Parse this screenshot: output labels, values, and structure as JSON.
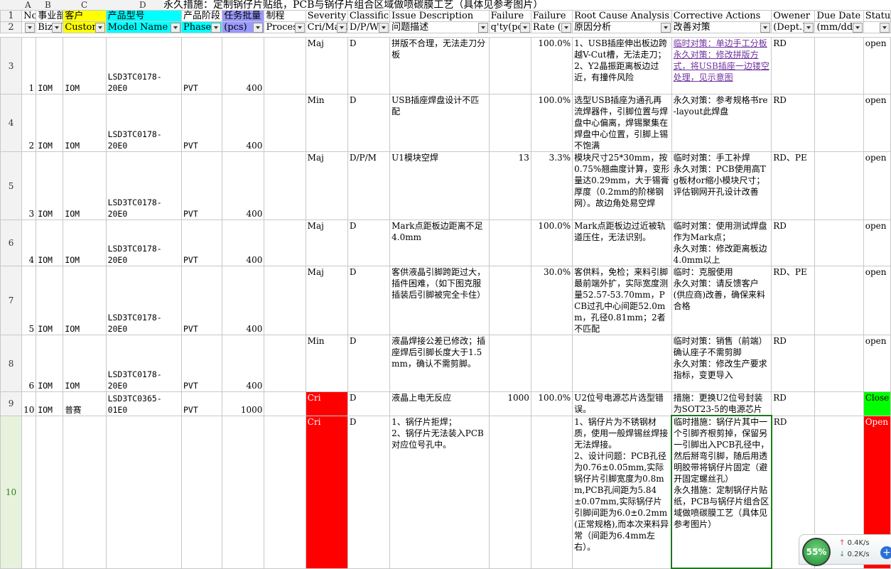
{
  "formula_bar": {
    "text": "永久措施：定制锅仔片贴纸，PCB与锅仔片组合区域做喷碳膜工艺（具体见参考图片）"
  },
  "columns": [
    "A",
    "B",
    "C",
    "D"
  ],
  "header_row1": {
    "rownum": "1",
    "no": "No.",
    "biz": "事业部",
    "customer": "客户",
    "model": "产品型号",
    "phase": "产品阶段",
    "batch": "任务批量",
    "process": "制程",
    "severity": "Severity",
    "classification": "Classification",
    "issue": "Issue Description",
    "failure_qty": "Failure",
    "failure_rate": "Failure",
    "root": "Root Cause Analysis",
    "corrective": "Corrective Actions",
    "owner": "Owener",
    "due": "Due Date",
    "status": "Status"
  },
  "header_row2": {
    "rownum": "2",
    "biz": "Biz U",
    "customer": "Custom",
    "model": "Model Name",
    "phase": "Phase",
    "batch": "(pcs)",
    "process": "Process",
    "severity": "Cri/Maj/M",
    "classification": "D/P/W/",
    "issue": "问题描述",
    "failure_qty": "q'ty(pc",
    "failure_rate": "Rate (%",
    "root": "原因分析",
    "corrective": "改善对策",
    "owner": "(Dept.)",
    "due": "(mm/dd)"
  },
  "rows": [
    {
      "rownum": "3",
      "no": "1",
      "biz": "IOM",
      "customer": "IOM",
      "model": "LSD3TC0178-20E0",
      "phase": "PVT",
      "batch": "400",
      "severity": "Maj",
      "cls": "D",
      "issue": "拼版不合理，无法走刀分板",
      "qty": "",
      "rate": "100.0%",
      "root": "1、USB插座伸出板边跨越V-Cut槽，无法走刀；\n2、Y2晶振距离板边过近，有撞件风险",
      "corrective": "临时对策：单边手工分板\n永久对策：修改拼版方式，将USB插座一边镂空处理，见示意图",
      "owner": "RD",
      "due": "",
      "status": "open"
    },
    {
      "rownum": "4",
      "no": "2",
      "biz": "IOM",
      "customer": "IOM",
      "model": "LSD3TC0178-20E0",
      "phase": "PVT",
      "batch": "400",
      "severity": "Min",
      "cls": "D",
      "issue": "USB插座焊盘设计不匹配",
      "qty": "",
      "rate": "100.0%",
      "root": "选型USB插座为通孔再流焊器件，引脚位置与焊盘中心偏离，焊锡聚集在焊盘中心位置，引脚上锡不饱满",
      "corrective": "永久对策：参考规格书re-layout此焊盘",
      "owner": "RD",
      "due": "",
      "status": "open"
    },
    {
      "rownum": "5",
      "no": "3",
      "biz": "IOM",
      "customer": "IOM",
      "model": "LSD3TC0178-20E0",
      "phase": "PVT",
      "batch": "400",
      "severity": "Maj",
      "cls": "D/P/M",
      "issue": "U1模块空焊",
      "qty": "13",
      "rate": "3.3%",
      "root": "模块尺寸25*30mm，按0.75%翘曲度计算，变形量达0.29mm，大于锡膏厚度（0.2mm的阶梯钢网）。故边角处易空焊",
      "corrective": "临时对策：手工补焊\n永久对策：PCB使用高Tg板材or缩小模块尺寸；评估钢网开孔设计改善",
      "owner": "RD、PE",
      "due": "",
      "status": "open"
    },
    {
      "rownum": "6",
      "no": "4",
      "biz": "IOM",
      "customer": "IOM",
      "model": "LSD3TC0178-20E0",
      "phase": "PVT",
      "batch": "400",
      "severity": "Maj",
      "cls": "D",
      "issue": "Mark点距板边距离不足4.0mm",
      "qty": "",
      "rate": "100.0%",
      "root": "Mark点距板边过近被轨道压住，无法识别。",
      "corrective": "临时对策：使用测试焊盘作为Mark点；\n永久对策：修改距离板边4.0mm以上",
      "owner": "RD",
      "due": "",
      "status": "open"
    },
    {
      "rownum": "7",
      "no": "5",
      "biz": "IOM",
      "customer": "IOM",
      "model": "LSD3TC0178-20E0",
      "phase": "PVT",
      "batch": "400",
      "severity": "Maj",
      "cls": "D",
      "issue": "客供液晶引脚跨距过大，插件困难，（如下图克服插装后引脚被完全卡住）",
      "qty": "",
      "rate": "30.0%",
      "root": "客供料，免检；来料引脚最前端外扩，实际宽度测量52.57-53.70mm，PCB过孔中心间距52.0mm，孔径0.81mm；2者不匹配",
      "corrective": "临时：克服使用\n永久对策：请反馈客户(供应商)改善，确保来料合格",
      "owner": "RD、PE",
      "due": "",
      "status": "open"
    },
    {
      "rownum": "8",
      "no": "6",
      "biz": "IOM",
      "customer": "IOM",
      "model": "LSD3TC0178-20E0",
      "phase": "PVT",
      "batch": "400",
      "severity": "Min",
      "cls": "D",
      "issue": "液晶焊接公差已修改；插座焊后引脚长度大于1.5mm，确认不需剪脚。",
      "qty": "",
      "rate": "",
      "root": "",
      "corrective": "临时对策：销售（前端）确认座子不需剪脚\n永久对策：修改生产要求指标，变更导入",
      "owner": "RD",
      "due": "",
      "status": "open"
    },
    {
      "rownum": "9",
      "no": "10",
      "biz": "IOM",
      "customer": "普赛",
      "model": "LSD3TC0365-01E0",
      "phase": "PVT",
      "batch": "1000",
      "severity": "Cri",
      "cls": "D",
      "issue": "液晶上电无反应",
      "qty": "1000",
      "rate": "100.0%",
      "root": "U2位号电源芯片选型错误。",
      "corrective": "措施：更换U2位号封装为SOT23-5的电源芯片",
      "owner": "RD",
      "due": "",
      "status": "Close"
    },
    {
      "rownum": "10",
      "no": "",
      "biz": "",
      "customer": "",
      "model": "",
      "phase": "",
      "batch": "",
      "severity": "Cri",
      "cls": "D",
      "issue": "1、锅仔片拒焊；\n2、锅仔片无法装入PCB对应位号孔中。",
      "qty": "",
      "rate": "",
      "root": "1、锅仔片为不锈钢材质，使用一般焊锡丝焊接无法焊接。\n2、设计问题：PCB孔径为0.76±0.05mm,实际锅仔片引脚宽度为0.8mm,PCB孔间距为5.84±0.07mm,实际锅仔片引脚间距为6.0±0.2mm(正常规格),而本次来料异常（间距为6.4mm左右）。",
      "corrective": "临时措施：锅仔片其中一个引脚齐根剪掉，保留另一引脚出入PCB孔径中，然后掰弯引脚，随后用透明胶带将锅仔片固定（避开固定螺丝孔）\n永久措施：定制锅仔片贴纸，PCB与锅仔片组合区域做喷碳膜工艺（具体见参考图片）",
      "owner": "RD",
      "due": "",
      "status": "Open"
    }
  ],
  "status_widget": {
    "cpu": "55%",
    "up": "0.4K/s",
    "down": "0.2K/s",
    "plus": "+"
  }
}
